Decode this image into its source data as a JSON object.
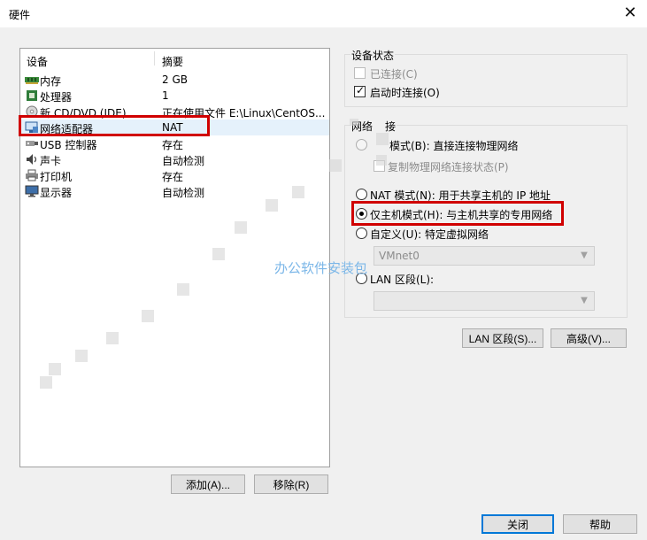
{
  "window": {
    "title": "硬件"
  },
  "device_list": {
    "headers": {
      "device": "设备",
      "summary": "摘要"
    },
    "rows": [
      {
        "name": "内存",
        "summary": "2 GB",
        "icon": "memory-icon"
      },
      {
        "name": "处理器",
        "summary": "1",
        "icon": "cpu-icon"
      },
      {
        "name": "新 CD/DVD (IDE)",
        "summary": "正在使用文件 E:\\Linux\\CentOS...",
        "icon": "cd-dvd-icon"
      },
      {
        "name": "网络适配器",
        "summary": "NAT",
        "icon": "network-adapter-icon"
      },
      {
        "name": "USB 控制器",
        "summary": "存在",
        "icon": "usb-icon"
      },
      {
        "name": "声卡",
        "summary": "自动检测",
        "icon": "sound-card-icon"
      },
      {
        "name": "打印机",
        "summary": "存在",
        "icon": "printer-icon"
      },
      {
        "name": "显示器",
        "summary": "自动检测",
        "icon": "display-icon"
      }
    ]
  },
  "left_buttons": {
    "add": "添加(A)...",
    "remove": "移除(R)"
  },
  "device_status": {
    "title": "设备状态",
    "connected": "已连接(C)",
    "connect_at_power_on": "启动时连接(O)"
  },
  "network_connection": {
    "title_part_a": "网络",
    "title_part_b": "接",
    "bridged": "模式(B): 直接连接物理网络",
    "replicate": "复制物理网络连接状态(P)",
    "nat": "NAT 模式(N): 用于共享主机的 IP 地址",
    "host_only": "仅主机模式(H): 与主机共享的专用网络",
    "custom": "自定义(U): 特定虚拟网络",
    "vmnet_value": "VMnet0",
    "lan_segment": "LAN 区段(L):",
    "lan_value": ""
  },
  "right_buttons": {
    "lan_segments": "LAN 区段(S)...",
    "advanced": "高级(V)..."
  },
  "footer": {
    "close": "关闭",
    "help": "帮助"
  },
  "watermark": "办公软件安装包",
  "colors": {
    "highlight_red": "#d00000",
    "selection_blue": "#e5f1fb",
    "focus_border": "#0078d7"
  }
}
